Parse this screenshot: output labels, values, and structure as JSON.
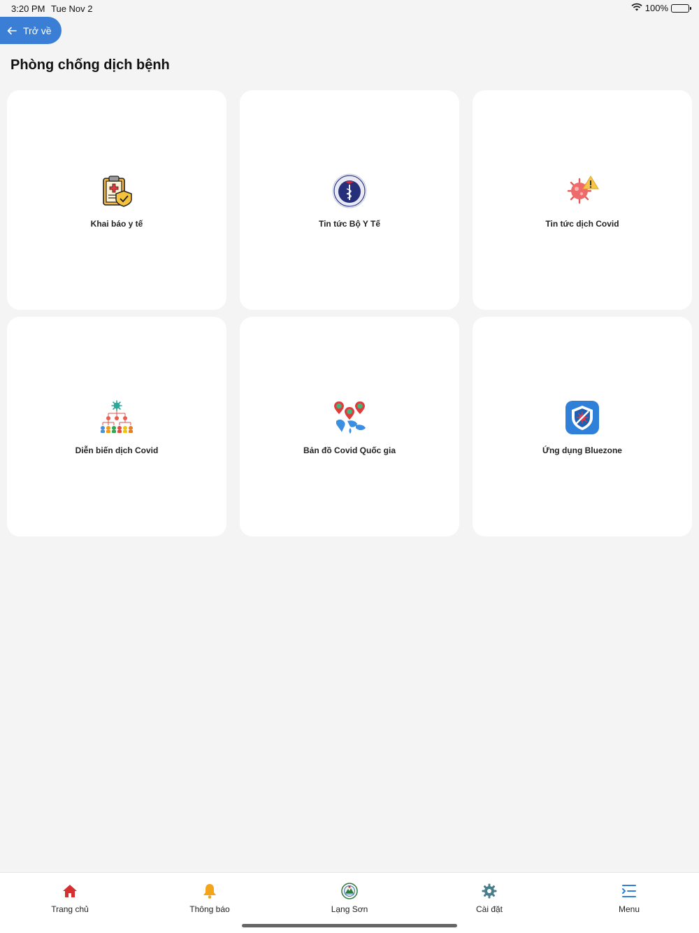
{
  "status_bar": {
    "time": "3:20 PM",
    "date": "Tue Nov 2",
    "battery": "100%"
  },
  "header": {
    "back_label": "Trở về",
    "title": "Phòng chống dịch bệnh"
  },
  "cards": [
    {
      "label": "Khai báo y tế",
      "icon": "medical-declaration-icon"
    },
    {
      "label": "Tin tức Bộ Y Tế",
      "icon": "ministry-of-health-icon"
    },
    {
      "label": "Tin tức dịch Covid",
      "icon": "covid-warning-icon"
    },
    {
      "label": "Diễn biến dịch Covid",
      "icon": "covid-tree-icon"
    },
    {
      "label": "Bản đồ Covid Quốc gia",
      "icon": "covid-map-icon"
    },
    {
      "label": "Ứng dụng Bluezone",
      "icon": "bluezone-shield-icon"
    }
  ],
  "bottom_nav": [
    {
      "label": "Trang chủ",
      "icon": "home-icon",
      "color": "#d62f2f"
    },
    {
      "label": "Thông báo",
      "icon": "bell-icon",
      "color": "#f2a51a"
    },
    {
      "label": "Lạng Sơn",
      "icon": "lang-son-emblem-icon",
      "color": "#2c7a3f"
    },
    {
      "label": "Cài đặt",
      "icon": "gear-icon",
      "color": "#4a7d8c"
    },
    {
      "label": "Menu",
      "icon": "menu-icon",
      "color": "#2f80d8"
    }
  ],
  "colors": {
    "accent": "#3a7fd5",
    "background": "#f4f4f4",
    "card": "#ffffff"
  }
}
